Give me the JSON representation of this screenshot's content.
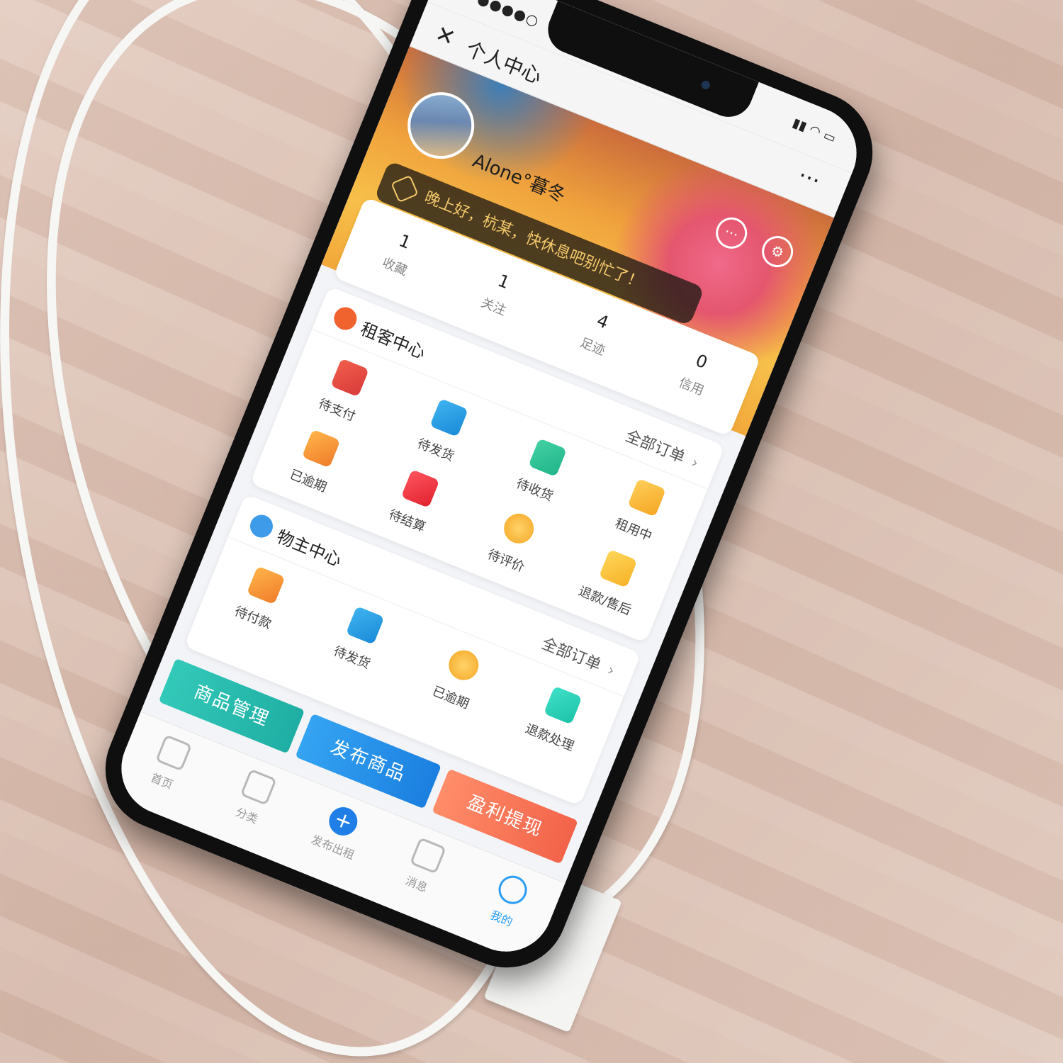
{
  "status_bar": {
    "signal": "●●●●○",
    "system_icons": "▮▮ ◠ ▭"
  },
  "nav": {
    "close_glyph": "✕",
    "title": "个人中心",
    "more_glyph": "···"
  },
  "profile": {
    "username": "Alone°暮冬",
    "greeting": "晚上好，杭某，快休息吧别忙了！"
  },
  "stats": [
    {
      "value": "1",
      "label": "收藏"
    },
    {
      "value": "1",
      "label": "关注"
    },
    {
      "value": "4",
      "label": "足迹"
    },
    {
      "value": "0",
      "label": "信用"
    }
  ],
  "renter_center": {
    "title": "租客中心",
    "all_orders": "全部订单",
    "items": [
      {
        "label": "待支付",
        "icon": "card-icon"
      },
      {
        "label": "待发货",
        "icon": "box-icon"
      },
      {
        "label": "待收货",
        "icon": "truck-icon"
      },
      {
        "label": "租用中",
        "icon": "hourglass-icon"
      },
      {
        "label": "已逾期",
        "icon": "tag-icon"
      },
      {
        "label": "待结算",
        "icon": "red-envelope-icon"
      },
      {
        "label": "待评价",
        "icon": "chat-bubble-icon"
      },
      {
        "label": "退款/售后",
        "icon": "refund-icon"
      }
    ]
  },
  "owner_center": {
    "title": "物主中心",
    "all_orders": "全部订单",
    "items": [
      {
        "label": "待付款",
        "icon": "wallet-icon"
      },
      {
        "label": "待发货",
        "icon": "clock-icon"
      },
      {
        "label": "已逾期",
        "icon": "coin-icon"
      },
      {
        "label": "退款处理",
        "icon": "lock-icon"
      }
    ]
  },
  "actions": [
    {
      "label": "商品管理"
    },
    {
      "label": "发布商品"
    },
    {
      "label": "盈利提现"
    }
  ],
  "tabbar": [
    {
      "label": "首页",
      "icon": "gamepad-icon",
      "active": false
    },
    {
      "label": "分类",
      "icon": "grid-search-icon",
      "active": false
    },
    {
      "label": "发布出租",
      "icon": "plus-icon",
      "active": false
    },
    {
      "label": "消息",
      "icon": "message-icon",
      "active": false
    },
    {
      "label": "我的",
      "icon": "profile-icon",
      "active": true
    }
  ],
  "colors": {
    "accent": "#2a9df4",
    "manage_button": "#1faea3",
    "publish_button": "#1b7fe0",
    "withdraw_button": "#f2634a"
  }
}
